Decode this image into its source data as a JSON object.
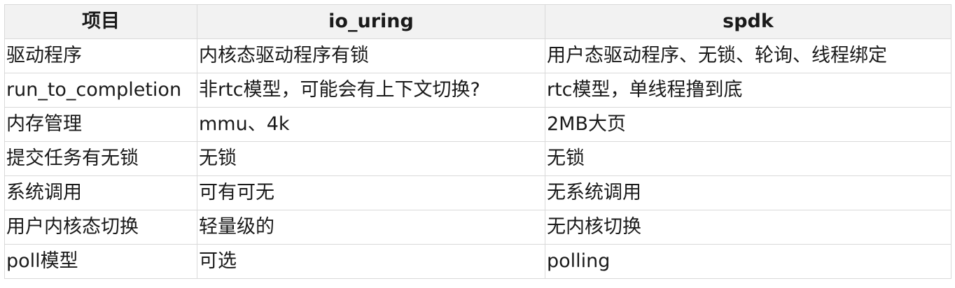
{
  "table": {
    "headers": [
      "项目",
      "io_uring",
      "spdk"
    ],
    "rows": [
      [
        "驱动程序",
        "内核态驱动程序有锁",
        "用户态驱动程序、无锁、轮询、线程绑定"
      ],
      [
        "run_to_completion",
        "非rtc模型，可能会有上下文切换?",
        "rtc模型，单线程撸到底"
      ],
      [
        "内存管理",
        "mmu、4k",
        "2MB大页"
      ],
      [
        "提交任务有无锁",
        "无锁",
        "无锁"
      ],
      [
        "系统调用",
        "可有可无",
        "无系统调用"
      ],
      [
        "用户内核态切换",
        "轻量级的",
        "无内核切换"
      ],
      [
        "poll模型",
        "可选",
        "polling"
      ]
    ]
  }
}
